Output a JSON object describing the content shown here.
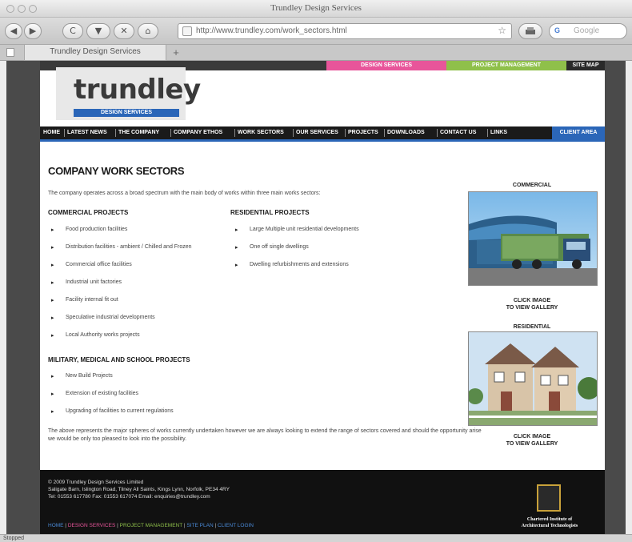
{
  "window": {
    "title": "Trundley Design Services"
  },
  "toolbar": {
    "back": "◀",
    "forward": "▶",
    "reload": "C",
    "download": "▼",
    "stop": "✕",
    "home": "⌂",
    "url": "http://www.trundley.com/work_sectors.html",
    "bookmark": "☆",
    "search_placeholder": "Google"
  },
  "tabs": [
    {
      "label": "Trundley Design Services"
    }
  ],
  "topstrip": {
    "design_services": "DESIGN SERVICES",
    "project_management": "PROJECT MANAGEMENT",
    "site_map": "SITE MAP"
  },
  "logo": {
    "name": "trundley",
    "subtitle": "DESIGN SERVICES"
  },
  "nav": [
    "HOME",
    "LATEST NEWS",
    "THE COMPANY",
    "COMPANY ETHOS",
    "WORK SECTORS",
    "OUR SERVICES",
    "PROJECTS",
    "DOWNLOADS",
    "CONTACT US",
    "LINKS"
  ],
  "client_area": "CLIENT AREA",
  "main": {
    "title": "COMPANY WORK SECTORS",
    "intro": "The company operates across a broad spectrum with the main body of works within three main works sectors:",
    "commercial": {
      "title": "COMMERCIAL PROJECTS",
      "items": [
        "Food production facilities",
        "Distribution facilities - ambient / Chilled and Frozen",
        "Commercial office facilities",
        "Industrial unit factories",
        "Facility internal fit out",
        "Speculative industrial developments",
        "Local Authority works projects"
      ]
    },
    "residential": {
      "title": "RESIDENTIAL PROJECTS",
      "items": [
        "Large Multiple unit residential developments",
        "One off single dwellings",
        "Dwelling refurbishments and extensions"
      ]
    },
    "military": {
      "title": "MILITARY, MEDICAL AND SCHOOL PROJECTS",
      "items": [
        "New Build Projects",
        "Extension of existing facilities",
        "Upgrading of facilities to current regulations"
      ]
    },
    "closing": "The above represents the major spheres of works currently undertaken however we are always looking to extend the range of sectors covered and should the opportunity arise we would be only too pleased to look into the possibility."
  },
  "sidebar": {
    "commercial_label": "COMMERCIAL",
    "residential_label": "RESIDENTIAL",
    "click_line1": "CLICK IMAGE",
    "click_line2": "TO VIEW GALLERY"
  },
  "footer": {
    "copyright": "© 2009 Trundley Design Services Limited",
    "address": "Saligate Barn, Islington Road, Tilney All Saints, Kings Lynn, Norfolk, PE34 4RY",
    "contact": "Tel: 01553 617780  Fax: 01553 617074  Email: enquiries@trundley.com",
    "links": [
      "HOME",
      "DESIGN SERVICES",
      "PROJECT MANAGEMENT",
      "SITE PLAN",
      "CLIENT LOGIN"
    ],
    "badge_line1": "Chartered Institute of",
    "badge_line2": "Architectural Technologists"
  },
  "status": {
    "text": "Stopped"
  },
  "colors": {
    "brand_blue": "#2b66b8",
    "pink": "#e8559a",
    "green": "#8fc04a"
  }
}
